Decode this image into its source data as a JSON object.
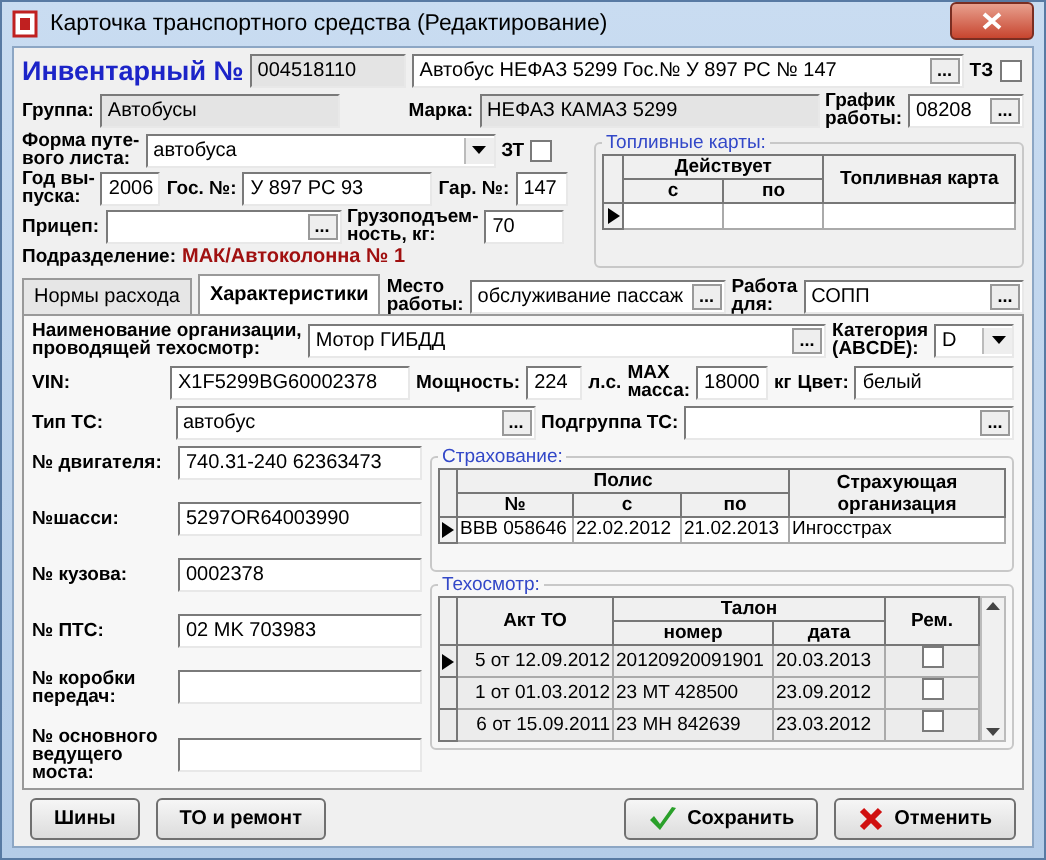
{
  "window": {
    "title": "Карточка транспортного средства (Редактирование)"
  },
  "header": {
    "inventory_label": "Инвентарный №",
    "inventory_number": "004518110",
    "vehicle": {
      "value": "Автобус  НЕФАЗ  5299  Гос.№ У 897 РС  № 147",
      "button": "..."
    },
    "tz": {
      "label": "ТЗ",
      "checked": false
    },
    "group": {
      "label": "Группа:",
      "value": "Автобусы"
    },
    "brand": {
      "label": "Марка:",
      "value": "НЕФАЗ КАМАЗ 5299"
    },
    "schedule": {
      "label": "График\nработы:",
      "value": "08208",
      "button": "..."
    }
  },
  "form": {
    "waybill_form": {
      "label": "Форма путе-\nвого листа:",
      "value": "автобуса"
    },
    "zt": {
      "label": "ЗТ",
      "checked": false
    },
    "year": {
      "label": "Год вы-\nпуска:",
      "value": "2006"
    },
    "plate": {
      "label": "Гос. №:",
      "value": "У 897 РС 93"
    },
    "garage": {
      "label": "Гар. №:",
      "value": "147"
    },
    "trailer": {
      "label": "Прицеп:",
      "button": "..."
    },
    "capacity": {
      "label": "Грузоподъем-\nность, кг:",
      "value": "70"
    },
    "division": {
      "label": "Подразделение:",
      "value": "МАК/Автоколонна № 1"
    }
  },
  "fuel_cards": {
    "title": "Топливные карты:",
    "columns": {
      "valid": "Действует",
      "from": "с",
      "to": "по",
      "card": "Топливная карта"
    }
  },
  "tabs": [
    {
      "label": "Нормы расхода",
      "selected": false
    },
    {
      "label": "Характеристики",
      "selected": true
    }
  ],
  "workplace": {
    "label": "Место\nработы:",
    "value": "обслуживание пассаж",
    "button": "..."
  },
  "work_for": {
    "label": "Работа\nдля:",
    "value": "СОПП",
    "button": "..."
  },
  "characteristics": {
    "inspection_org": {
      "label": "Наименование организации,\nпроводящей техосмотр:",
      "value": "Мотор ГИБДД",
      "button": "..."
    },
    "category": {
      "label": "Категория\n(ABCDE):",
      "value": "D"
    },
    "vin": {
      "label": "VIN:",
      "value": "X1F5299BG60002378"
    },
    "power": {
      "label": "Мощность:",
      "value": "224",
      "unit": "л.с."
    },
    "max_mass": {
      "label": "MAX\nмасса:",
      "value": "18000",
      "unit": "кг"
    },
    "color": {
      "label": "Цвет:",
      "value": "белый"
    },
    "type": {
      "label": "Тип ТС:",
      "value": "автобус",
      "button": "..."
    },
    "subgroup": {
      "label": "Подгруппа ТС:",
      "button": "..."
    },
    "numbers": [
      {
        "label": "№ двигателя:",
        "value": "740.31-240 62363473"
      },
      {
        "label": "№шасси:",
        "value": "5297OR64003990"
      },
      {
        "label": "№ кузова:",
        "value": "0002378"
      },
      {
        "label": "№ ПТС:",
        "value": "02 MK 703983"
      },
      {
        "label": "№ коробки\nпередач:"
      },
      {
        "label": "№ основного\nведущего\nмоста:"
      }
    ],
    "insurance": {
      "title": "Страхование:",
      "columns": {
        "policy": "Полис",
        "number": "№",
        "from": "с",
        "to": "по",
        "insurer": "Страхующая организация"
      },
      "rows": [
        {
          "number": "ВВВ 058646",
          "from": "22.02.2012",
          "to": "21.02.2013",
          "insurer": "Ингосстрах",
          "selected": true
        }
      ]
    },
    "inspection": {
      "title": "Техосмотр:",
      "columns": {
        "act": "Акт ТО",
        "coupon": "Талон",
        "number": "номер",
        "date": "дата",
        "repair": "Рем."
      },
      "rows": [
        {
          "act": "5 от 12.09.2012",
          "number": "20120920091901",
          "date": "20.03.2013",
          "repair": false,
          "selected": true
        },
        {
          "act": "1 от 01.03.2012",
          "number": "23 MT 428500",
          "date": "23.09.2012",
          "repair": false,
          "selected": false
        },
        {
          "act": "6 от 15.09.2011",
          "number": "23 MH 842639",
          "date": "23.03.2012",
          "repair": false,
          "selected": false
        }
      ]
    }
  },
  "buttons": [
    {
      "label": "Шины",
      "kind": "plain"
    },
    {
      "label": "ТО и ремонт",
      "kind": "plain"
    },
    {
      "label": "Сохранить",
      "kind": "save"
    },
    {
      "label": "Отменить",
      "kind": "cancel"
    }
  ]
}
